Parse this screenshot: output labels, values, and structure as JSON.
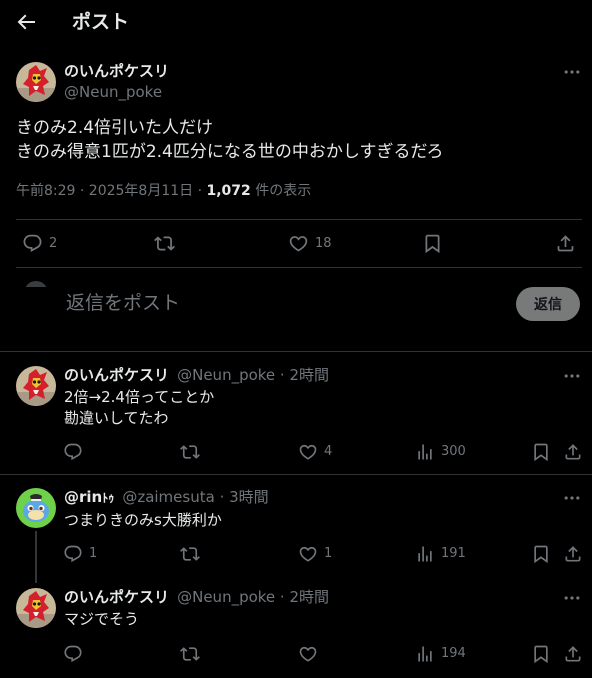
{
  "header": {
    "title": "ポスト"
  },
  "main_post": {
    "display_name": "のいんポケスリ",
    "handle": "@Neun_poke",
    "text_line1": "きのみ2.4倍引いた人だけ",
    "text_line2": "きのみ得意1匹が2.4匹分になる世の中おかしすぎるだろ",
    "time": "午前8:29 · 2025年8月11日 · ",
    "views": "1,072",
    "views_suffix": " 件の表示",
    "replies": "2",
    "likes": "18"
  },
  "composer": {
    "placeholder": "返信をポスト",
    "button": "返信"
  },
  "replies": [
    {
      "display_name": "のいんポケスリ",
      "meta": "@Neun_poke · 2時間",
      "line1": "2倍→2.4倍ってことか",
      "line2": "勘違いしてたわ",
      "likes": "4",
      "views": "300"
    },
    {
      "display_name": "@rin",
      "name_badge": "ﾄｩ",
      "meta": "@zaimesuta · 3時間",
      "line1": "つまりきのみs大勝利か",
      "replies": "1",
      "likes": "1",
      "views": "191"
    },
    {
      "display_name": "のいんポケスリ",
      "meta": "@Neun_poke · 2時間",
      "line1": "マジでそう",
      "views": "194"
    }
  ],
  "colors": {
    "background": "#000000",
    "text": "#e7e9ea",
    "secondary": "#71767b",
    "divider": "#2f3336",
    "reply_button": "#787a7a"
  },
  "icons": [
    "back-arrow-icon",
    "more-icon",
    "reply-icon",
    "repost-icon",
    "like-icon",
    "views-icon",
    "bookmark-icon",
    "share-icon"
  ]
}
